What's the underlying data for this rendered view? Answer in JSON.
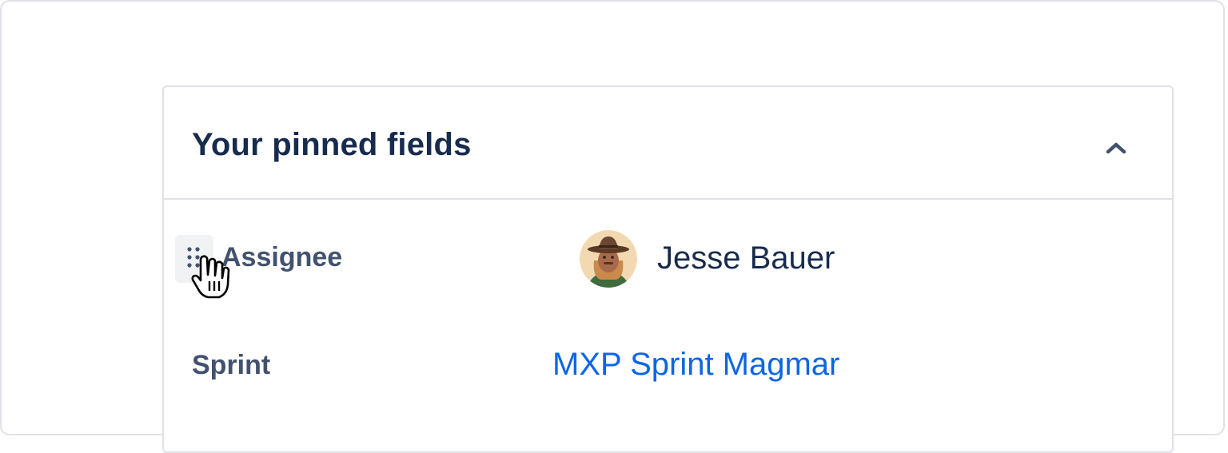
{
  "panel": {
    "title": "Your pinned fields",
    "collapse_icon": "chevron-up-icon"
  },
  "fields": [
    {
      "label": "Assignee",
      "value": "Jesse Bauer",
      "avatar_icon": "user-avatar",
      "drag_icon": "drag-handle-icon"
    },
    {
      "label": "Sprint",
      "value": "MXP Sprint Magmar"
    }
  ],
  "cursor_icon": "hand-pointer-icon",
  "colors": {
    "title": "#172b4d",
    "label": "#42526e",
    "link": "#0c66e4",
    "border": "#dfe1e6",
    "handle_bg": "#f1f2f4"
  }
}
